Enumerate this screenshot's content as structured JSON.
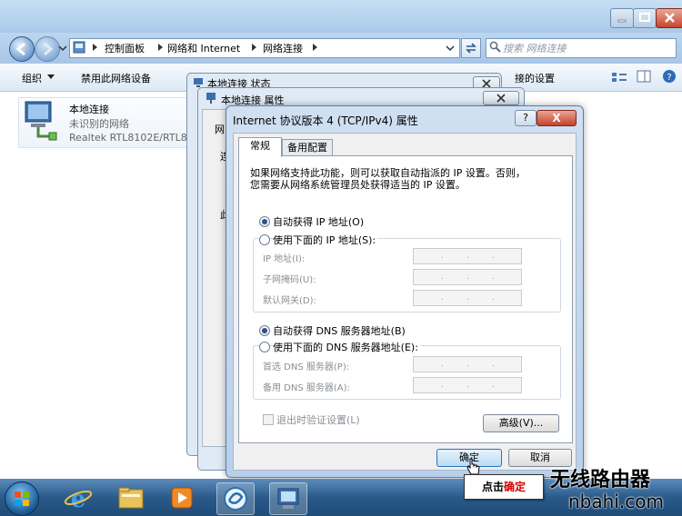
{
  "explorer": {
    "breadcrumb": [
      "控制面板",
      "网络和 Internet",
      "网络连接"
    ],
    "search_placeholder": "搜索 网络连接",
    "toolbar": {
      "organize": "组织",
      "disable": "禁用此网络设备",
      "partial_right": "接的设置"
    },
    "connection": {
      "name": "本地连接",
      "status": "未识别的网络",
      "device": "Realtek RTL8102E/RTL8"
    }
  },
  "bg_dialogs": {
    "status_title": "本地连接 状态",
    "props_title": "本地连接 属性",
    "frag_1": "网",
    "frag_2": "连",
    "frag_3": "此"
  },
  "dialog": {
    "title": "Internet 协议版本 4 (TCP/IPv4) 属性",
    "help": "?",
    "close": "X",
    "tabs": [
      "常规",
      "备用配置"
    ],
    "description_lines": [
      "如果网络支持此功能，则可以获取自动指派的 IP 设置。否则，",
      "您需要从网络系统管理员处获得适当的 IP 设置。"
    ],
    "ip": {
      "auto_label": "自动获得 IP 地址(O)",
      "manual_label": "使用下面的 IP 地址(S):",
      "auto_selected": true,
      "fields": [
        "IP 地址(I):",
        "子网掩码(U):",
        "默认网关(D):"
      ]
    },
    "dns": {
      "auto_label": "自动获得 DNS 服务器地址(B)",
      "manual_label": "使用下面的 DNS 服务器地址(E):",
      "auto_selected": true,
      "fields": [
        "首选 DNS 服务器(P):",
        "备用 DNS 服务器(A):"
      ]
    },
    "validate_label": "退出时验证设置(L)",
    "validate_checked": false,
    "advanced": "高级(V)...",
    "ok": "确定",
    "cancel": "取消"
  },
  "callout": {
    "prefix": "点击",
    "highlight": "确定"
  },
  "watermark": {
    "line1": "无线路由器",
    "line2": "nbahi.com"
  },
  "colors": {
    "accent": "#2b74b8",
    "callout_highlight": "#d40000",
    "taskbar": "#2a5a8a"
  }
}
